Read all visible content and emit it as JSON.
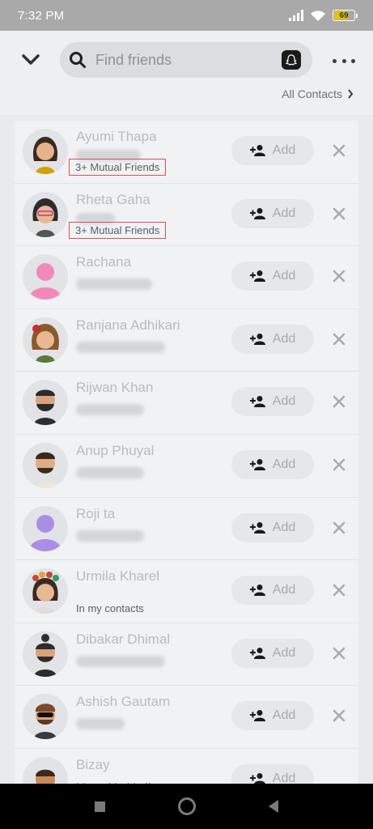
{
  "status_bar": {
    "time": "7:32 PM",
    "battery": "69"
  },
  "header": {
    "search_placeholder": "Find friends",
    "all_contacts_label": "All Contacts"
  },
  "contacts": [
    {
      "name": "Ayumi Thapa",
      "subtitle": "3+ Mutual Friends",
      "add_label": "Add",
      "avatar_color": "#3b2a22"
    },
    {
      "name": "Rheta Gaha",
      "subtitle": "3+ Mutual Friends",
      "add_label": "Add",
      "avatar_color": "#2c2c2c"
    },
    {
      "name": "Rachana",
      "subtitle": "",
      "add_label": "Add",
      "avatar_color": "#f08ab8"
    },
    {
      "name": "Ranjana Adhikari",
      "subtitle": "",
      "add_label": "Add",
      "avatar_color": "#8a5a2e"
    },
    {
      "name": "Rijwan Khan",
      "subtitle": "",
      "add_label": "Add",
      "avatar_color": "#2b2b2b"
    },
    {
      "name": "Anup Phuyal",
      "subtitle": "",
      "add_label": "Add",
      "avatar_color": "#3a2a1e"
    },
    {
      "name": "Roji ta",
      "subtitle": "",
      "add_label": "Add",
      "avatar_color": "#a98ee6"
    },
    {
      "name": "Urmila Kharel",
      "subtitle": "In my contacts",
      "add_label": "Add",
      "avatar_color": "#c44b3a"
    },
    {
      "name": "Dibakar Dhimal",
      "subtitle": "",
      "add_label": "Add",
      "avatar_color": "#2d2d2d"
    },
    {
      "name": "Ashish Gautam",
      "subtitle": "",
      "add_label": "Add",
      "avatar_color": "#7a4a2c"
    },
    {
      "name": "Bizay",
      "subtitle": "bizay_khokhali",
      "add_label": "Add",
      "avatar_color": "#3b2a1e"
    }
  ]
}
